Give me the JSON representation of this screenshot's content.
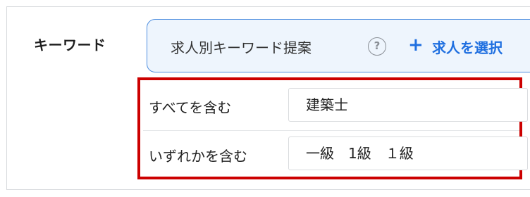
{
  "keyword_field": {
    "label": "キーワード",
    "suggest": {
      "text": "求人別キーワード提案",
      "help_glyph": "?",
      "add_glyph": "+",
      "select_text": "求人を選択"
    }
  },
  "conditions": [
    {
      "label": "すべてを含む",
      "value": "建築士"
    },
    {
      "label": "いずれかを含む",
      "value": "一級　1級　１級"
    }
  ],
  "colors": {
    "accent": "#1f6fe0",
    "suggest_bg": "#eef5fd",
    "highlight_border": "#cc0000"
  }
}
